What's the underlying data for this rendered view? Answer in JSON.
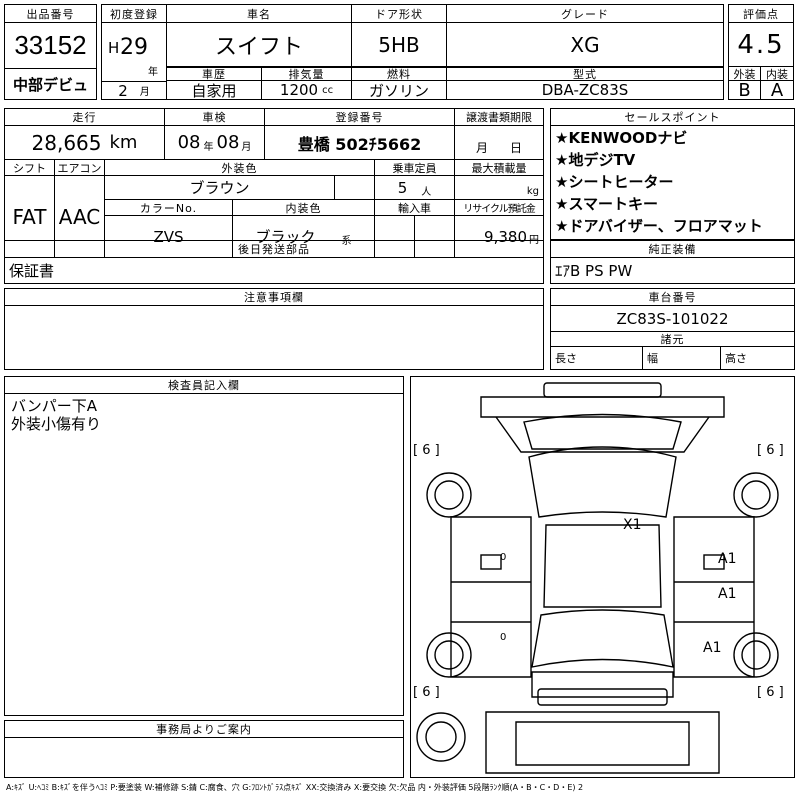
{
  "header": {
    "lot_label": "出品番号",
    "lot_number": "33152",
    "event_label": "中部デビュ",
    "first_reg_label": "初度登録",
    "era": "H",
    "year": "29",
    "year_unit": "年",
    "month": "2",
    "month_unit": "月",
    "car_name_label": "車名",
    "car_name": "スイフト",
    "door_label": "ドア形状",
    "door": "5HB",
    "grade_label": "グレード",
    "grade": "XG",
    "score_label": "評価点",
    "score": "4.5",
    "history_label": "車歴",
    "history": "自家用",
    "displacement_label": "排気量",
    "displacement": "1200",
    "displacement_unit": "cc",
    "fuel_label": "燃料",
    "fuel": "ガソリン",
    "model_label": "型式",
    "model": "DBA-ZC83S",
    "exterior_label": "外装",
    "exterior_grade": "B",
    "interior_label": "内装",
    "interior_grade": "A"
  },
  "row2": {
    "mileage_label": "走行",
    "mileage": "28,665",
    "mileage_unit": "km",
    "inspection_label": "車検",
    "insp_year": "08",
    "insp_year_unit": "年",
    "insp_month": "08",
    "insp_month_unit": "月",
    "reg_no_label": "登録番号",
    "reg_no": "豊橋 502ﾁ5662",
    "transfer_label": "譲渡書類期限",
    "transfer_month": "月",
    "transfer_day": "日",
    "shift_label": "シフト",
    "shift": "FAT",
    "ac_label": "エアコン",
    "ac": "AAC",
    "ext_color_label": "外装色",
    "ext_color": "ブラウン",
    "capacity_label": "乗車定員",
    "capacity": "5",
    "capacity_unit": "人",
    "load_label": "最大積載量",
    "load_unit": "kg",
    "color_no_label": "カラーNo.",
    "color_no": "ZVS",
    "int_color_label": "内装色",
    "int_color": "ブラック",
    "int_color_unit": "系",
    "import_label": "輸入車",
    "recycle_label": "リサイクル預託金",
    "recycle": "9,380",
    "recycle_unit": "円"
  },
  "selling_points": {
    "label": "セールスポイント",
    "items": [
      "★KENWOODナビ",
      "★地デジTV",
      "★シートヒーター",
      "★スマートキー",
      "★ドアバイザー、フロアマット"
    ]
  },
  "later_parts": {
    "label": "後日発送部品",
    "value": "保証書"
  },
  "standard_equipment": {
    "label": "純正装備",
    "value": "ｴｱB PS PW"
  },
  "notes": {
    "label": "注意事項欄"
  },
  "chassis": {
    "label": "車台番号",
    "value": "ZC83S-101022"
  },
  "dimensions": {
    "label": "諸元",
    "length": "長さ",
    "width": "幅",
    "height": "高さ"
  },
  "inspector": {
    "label": "検査員記入欄",
    "lines": [
      "バンパー下A",
      "外装小傷有り"
    ]
  },
  "office": {
    "label": "事務局よりご案内"
  },
  "diagram": {
    "tire_marks": [
      "[ 6 ]",
      "[ 6 ]",
      "[ 6 ]",
      "[ 6 ]"
    ],
    "damage": [
      "X1",
      "A1",
      "A1",
      "A1"
    ],
    "zeros": [
      "0",
      "0"
    ]
  },
  "legend": "A:ｷｽﾞ U:ﾍｺﾐ B:ｷｽﾞを伴うﾍｺﾐ P:要塗装 W:補修跡 S:錆 C:腐食、穴 G:ﾌﾛﾝﾄｶﾞﾗｽ点ｷｽﾞ XX:交換済み X:要交換 欠:欠品 内・外装評価 5段階ﾗﾝｸ順(A・B・C・D・E) 2"
}
